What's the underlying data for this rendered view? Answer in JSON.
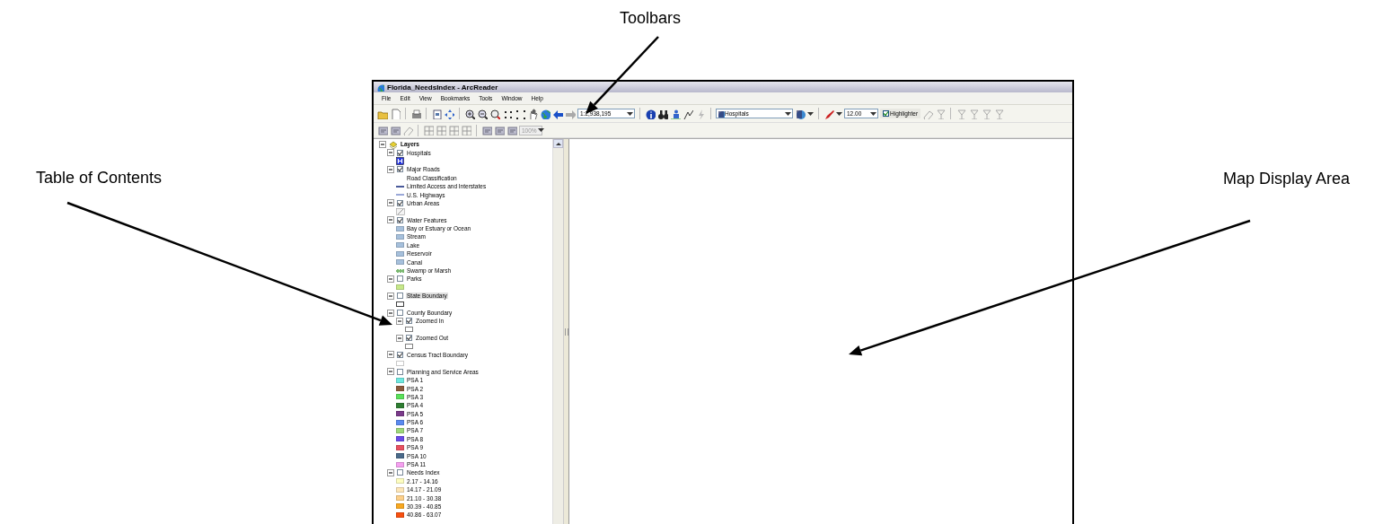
{
  "annotations": [
    {
      "text": "Toolbars"
    },
    {
      "text": "Table of Contents"
    },
    {
      "text": "Map Display Area"
    }
  ],
  "window": {
    "title": "Florida_NeedsIndex - ArcReader"
  },
  "menu": [
    "File",
    "Edit",
    "View",
    "Bookmarks",
    "Tools",
    "Window",
    "Help"
  ],
  "toolbar": {
    "scale": "1:2,938,195",
    "layer_dropdown": "Hospitals",
    "font_size": "12.00",
    "highlighter": {
      "label": "Highlighter",
      "checked": true
    },
    "zoom_dropdown": {
      "value": "100%",
      "disabled": true
    }
  },
  "toc": {
    "root": {
      "label": "Layers",
      "expanded": true
    },
    "layers": [
      {
        "label": "Hospitals",
        "expanded": true,
        "checked": true,
        "selected": false,
        "legend": [
          {
            "kind": "hospital"
          }
        ]
      },
      {
        "label": "Major Roads",
        "expanded": true,
        "checked": true,
        "selected": false,
        "legend": [
          {
            "kind": "heading",
            "label": "Road Classification"
          },
          {
            "kind": "line",
            "label": "Limited Access and Interstates",
            "color": "#4a5a9a"
          },
          {
            "kind": "line",
            "label": "U.S. Highways",
            "color": "#9aa8d8"
          }
        ]
      },
      {
        "label": "Urban Areas",
        "expanded": true,
        "checked": true,
        "selected": false,
        "legend": [
          {
            "kind": "hatch"
          }
        ]
      },
      {
        "label": "Water Features",
        "expanded": true,
        "checked": true,
        "selected": false,
        "legend": [
          {
            "kind": "swatch",
            "label": "Bay or Estuary or Ocean",
            "color": "#a6c0dc"
          },
          {
            "kind": "swatch",
            "label": "Stream",
            "color": "#a6c0dc"
          },
          {
            "kind": "swatch",
            "label": "Lake",
            "color": "#a6c0dc"
          },
          {
            "kind": "swatch",
            "label": "Reservoir",
            "color": "#a6c0dc"
          },
          {
            "kind": "swatch",
            "label": "Canal",
            "color": "#a6c0dc"
          },
          {
            "kind": "marsh",
            "label": "Swamp or Marsh",
            "color": "#7ab870"
          }
        ]
      },
      {
        "label": "Parks",
        "expanded": true,
        "checked": false,
        "selected": false,
        "legend": [
          {
            "kind": "swatch",
            "color": "#c6e88a"
          }
        ]
      },
      {
        "label": "State Boundary",
        "expanded": true,
        "checked": false,
        "selected": true,
        "legend": [
          {
            "kind": "outline",
            "color": "#404040"
          }
        ]
      },
      {
        "label": "County Boundary",
        "expanded": true,
        "checked": false,
        "selected": false,
        "children": [
          {
            "label": "Zoomed In",
            "expanded": true,
            "checked": true,
            "selected": false,
            "legend": [
              {
                "kind": "outline",
                "color": "#808080"
              }
            ]
          },
          {
            "label": "Zoomed Out",
            "expanded": true,
            "checked": true,
            "selected": false,
            "legend": [
              {
                "kind": "outline",
                "color": "#808080"
              }
            ]
          }
        ]
      },
      {
        "label": "Census Tract Boundary",
        "expanded": true,
        "checked": true,
        "selected": false,
        "legend": [
          {
            "kind": "outline",
            "color": "#c8c8c8"
          }
        ]
      },
      {
        "label": "Planning and Service Areas",
        "expanded": true,
        "checked": false,
        "selected": false,
        "legend": [
          {
            "kind": "swatch",
            "label": "PSA 1",
            "color": "#6ee8e0"
          },
          {
            "kind": "swatch",
            "label": "PSA 2",
            "color": "#8b5a3c"
          },
          {
            "kind": "swatch",
            "label": "PSA 3",
            "color": "#5ae05a"
          },
          {
            "kind": "swatch",
            "label": "PSA 4",
            "color": "#2e7d32"
          },
          {
            "kind": "swatch",
            "label": "PSA 5",
            "color": "#7a3a8a"
          },
          {
            "kind": "swatch",
            "label": "PSA 6",
            "color": "#5a8af0"
          },
          {
            "kind": "swatch",
            "label": "PSA 7",
            "color": "#9ed87a"
          },
          {
            "kind": "swatch",
            "label": "PSA 8",
            "color": "#6a4ae8"
          },
          {
            "kind": "swatch",
            "label": "PSA 9",
            "color": "#e85060"
          },
          {
            "kind": "swatch",
            "label": "PSA 10",
            "color": "#4a6a8a"
          },
          {
            "kind": "swatch",
            "label": "PSA 11",
            "color": "#f5a0f0"
          }
        ]
      },
      {
        "label": "Needs Index",
        "expanded": true,
        "checked": false,
        "selected": false,
        "legend": [
          {
            "kind": "swatch",
            "label": "2.17 - 14.16",
            "color": "#fdfdc0"
          },
          {
            "kind": "swatch",
            "label": "14.17 - 21.09",
            "color": "#fde6b8"
          },
          {
            "kind": "swatch",
            "label": "21.10 - 30.38",
            "color": "#fdd08a"
          },
          {
            "kind": "swatch",
            "label": "30.39 - 40.85",
            "color": "#f8a820"
          },
          {
            "kind": "swatch",
            "label": "40.86 - 63.07",
            "color": "#f85010"
          }
        ]
      }
    ]
  }
}
